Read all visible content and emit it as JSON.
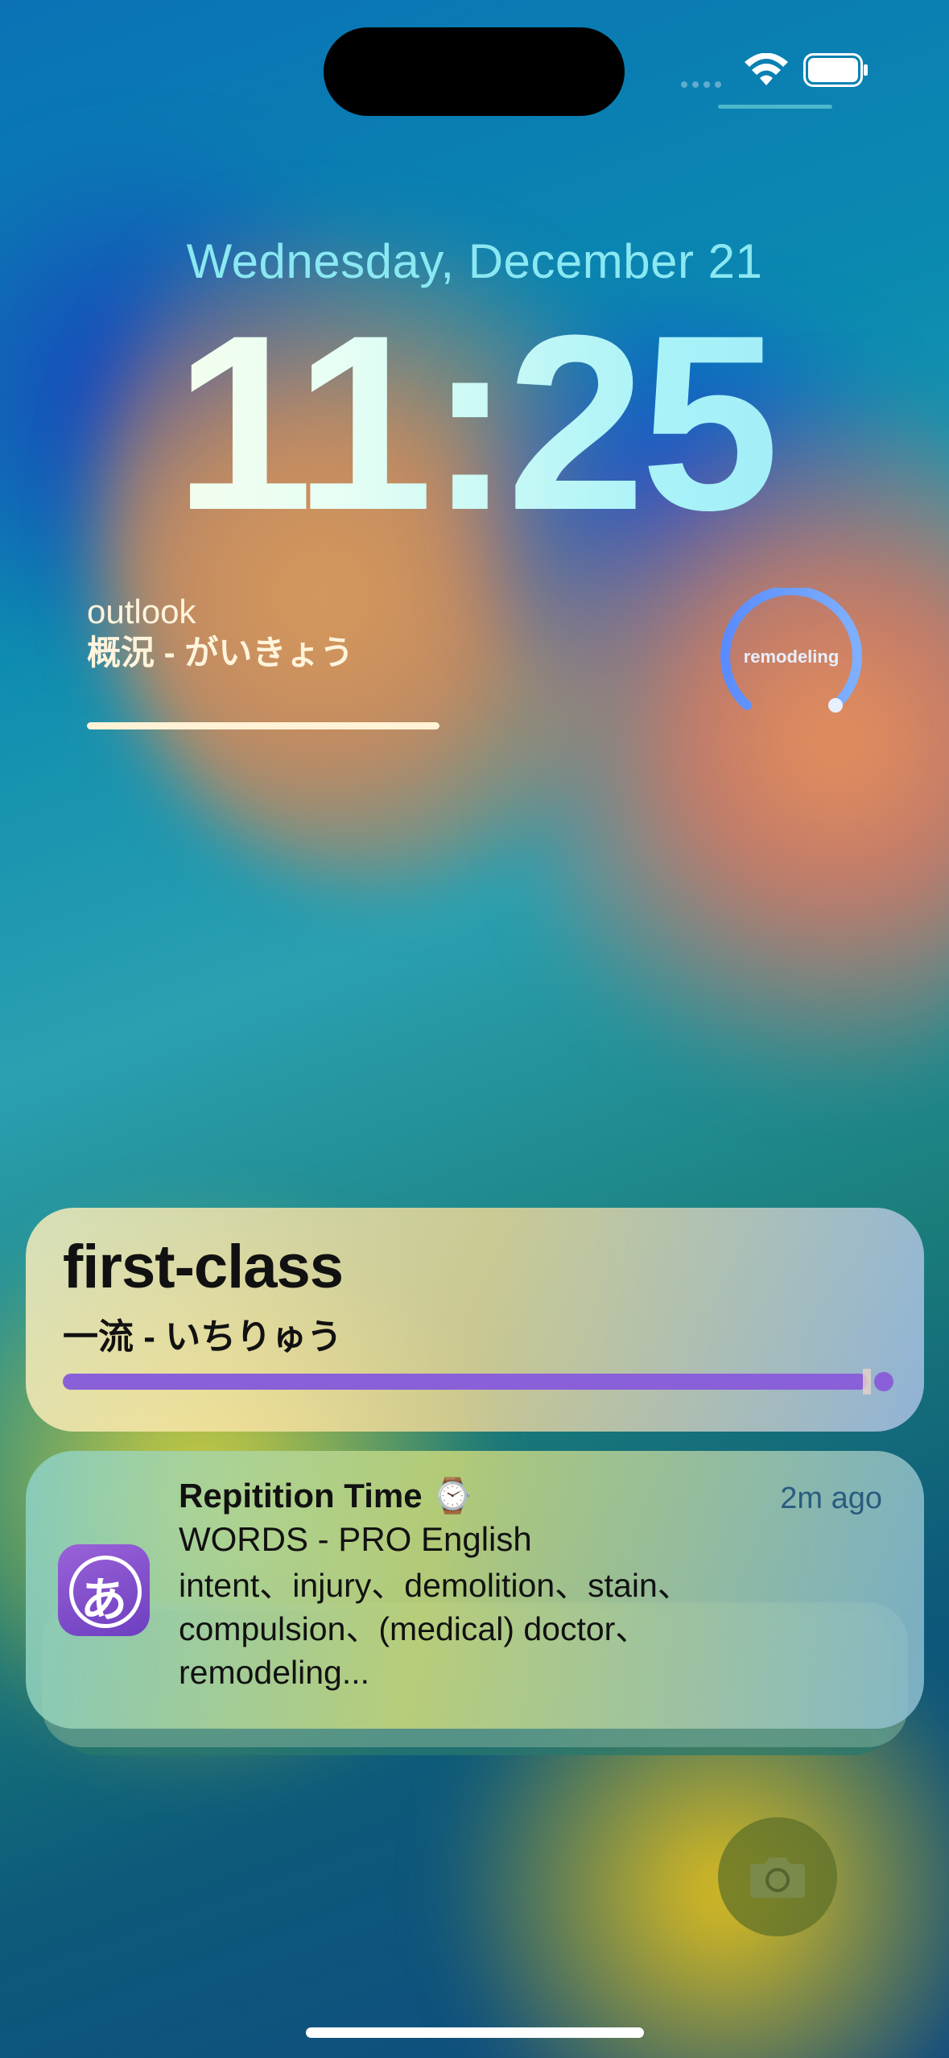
{
  "status_bar": {
    "wifi_icon": "wifi-icon",
    "battery_icon": "battery-icon"
  },
  "lock_screen": {
    "date": "Wednesday, December 21",
    "time": "11:25"
  },
  "word_widget": {
    "english": "outlook",
    "japanese": "概況 - がいきょう"
  },
  "gauge_widget": {
    "label": "remodeling",
    "accent": "#6aa0ff"
  },
  "live_activity": {
    "title": "first-class",
    "subtitle": "一流 - いちりゅう",
    "progress": 1.0,
    "accent": "#8a60d8"
  },
  "notification": {
    "app_icon": "hiragana-a-icon",
    "title": "Repitition Time ⌚",
    "time": "2m ago",
    "subtitle": "WORDS - PRO English",
    "body": "intent、injury、demolition、stain、compulsion、(medical) doctor、remodeling..."
  },
  "bottom": {
    "camera_icon": "camera-icon"
  }
}
